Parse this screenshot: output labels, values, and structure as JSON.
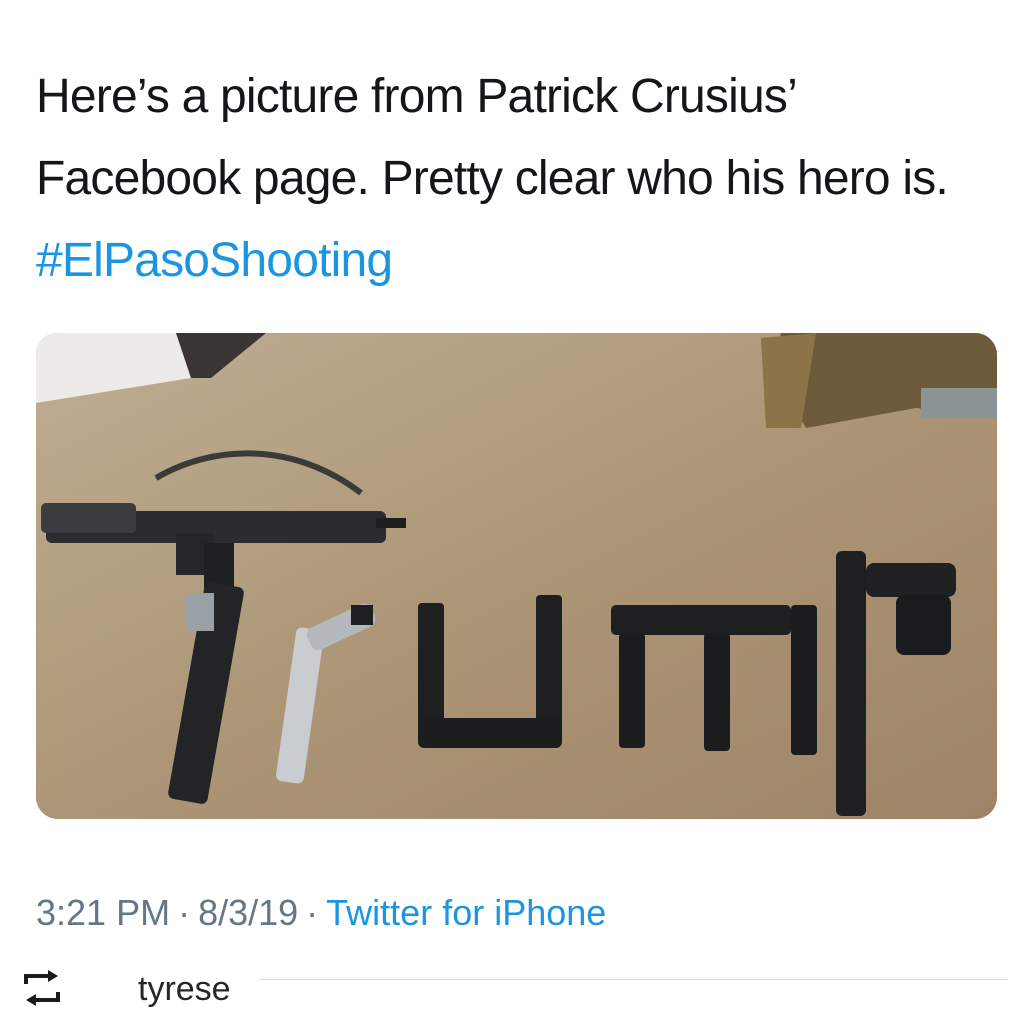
{
  "tweet": {
    "text": "Here’s a picture from Patrick Crusius’ Facebook page. Pretty clear who his hero is.",
    "hashtag": "#ElPasoShooting",
    "time": "3:21 PM",
    "separator": "·",
    "date": "8/3/19",
    "source": "Twitter for iPhone"
  },
  "repost": {
    "icon": "repost-icon",
    "username": "tyrese"
  },
  "colors": {
    "link": "#1b95e0",
    "text": "#14171a",
    "meta": "#657786"
  }
}
